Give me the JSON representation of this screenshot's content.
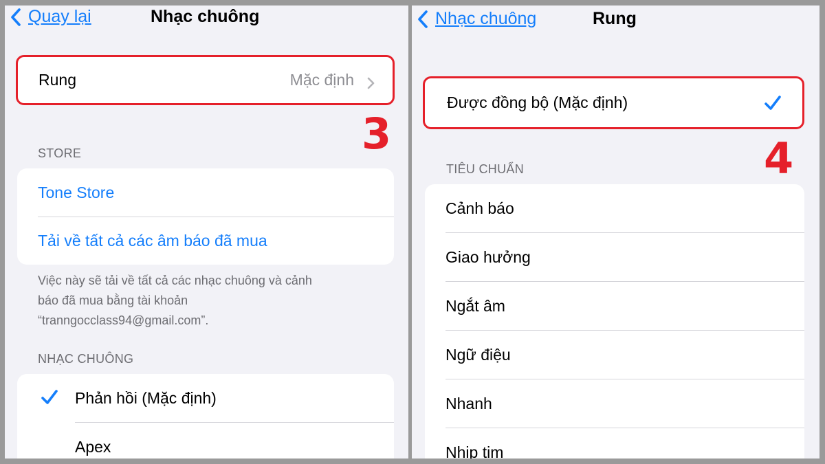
{
  "left_screen": {
    "nav": {
      "back_label": "Quay lại",
      "title": "Nhạc chuông"
    },
    "vibration_row": {
      "label": "Rung",
      "value": "Mặc định"
    },
    "step_marker": "3",
    "store_section": {
      "header": "STORE",
      "items": [
        "Tone Store",
        "Tải về tất cả các âm báo đã mua"
      ],
      "footer_lines": [
        "Việc này sẽ tải về tất cả các nhạc chuông và cảnh",
        "báo đã mua bằng tài khoản",
        "“tranngocclass94@gmail.com”."
      ]
    },
    "ringtone_section": {
      "header": "NHẠC CHUÔNG",
      "items": [
        {
          "label": "Phản hồi (Mặc định)",
          "selected": true
        },
        {
          "label": "Apex",
          "selected": false
        }
      ]
    }
  },
  "right_screen": {
    "nav": {
      "back_label": "Nhạc chuông",
      "title": "Rung"
    },
    "synced_row": {
      "label": "Được đồng bộ (Mặc định)",
      "selected": true
    },
    "step_marker": "4",
    "standard_section": {
      "header": "TIÊU CHUẨN",
      "items": [
        "Cảnh báo",
        "Giao hưởng",
        "Ngắt âm",
        "Ngữ điệu",
        "Nhanh",
        "Nhịp tim"
      ]
    }
  },
  "colors": {
    "accent_blue": "#147efb",
    "highlight_red": "#e5202a",
    "background_grouped": "#f2f2f7"
  },
  "icons": {
    "back": "chevron-left-icon",
    "disclosure": "chevron-right-icon",
    "selected": "checkmark-icon"
  }
}
